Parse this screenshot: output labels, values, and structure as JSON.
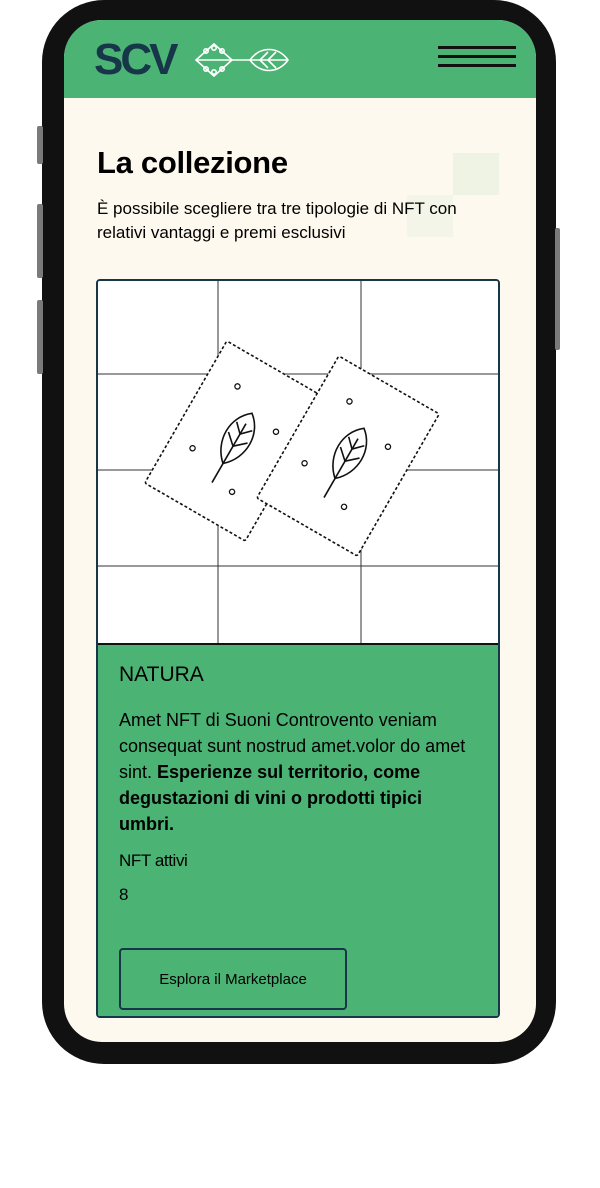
{
  "header": {
    "logo_text": "SCV",
    "logo_mark": "leaf-circuit-logo",
    "menu_icon": "hamburger-menu-icon"
  },
  "main": {
    "title": "La collezione",
    "subtitle": "È possibile scegliere tra tre tipologie di NFT con relativi vantaggi e premi esclusivi"
  },
  "card": {
    "illustration": "stamp-leaf-illustration",
    "title": "NATURA",
    "description_plain": "Amet NFT di Suoni Controvento veniam consequat sunt nostrud amet.volor do amet sint.",
    "description_bold": "Esperienze sul territorio, come degustazioni di vini o prodotti tipici umbri.",
    "nft_label": "NFT attivi",
    "nft_count": "8",
    "cta_label": "Esplora il Marketplace"
  },
  "colors": {
    "header_green": "#4bb373",
    "background_cream": "#fdf9ef",
    "navy": "#17364a",
    "frame": "#111111"
  }
}
